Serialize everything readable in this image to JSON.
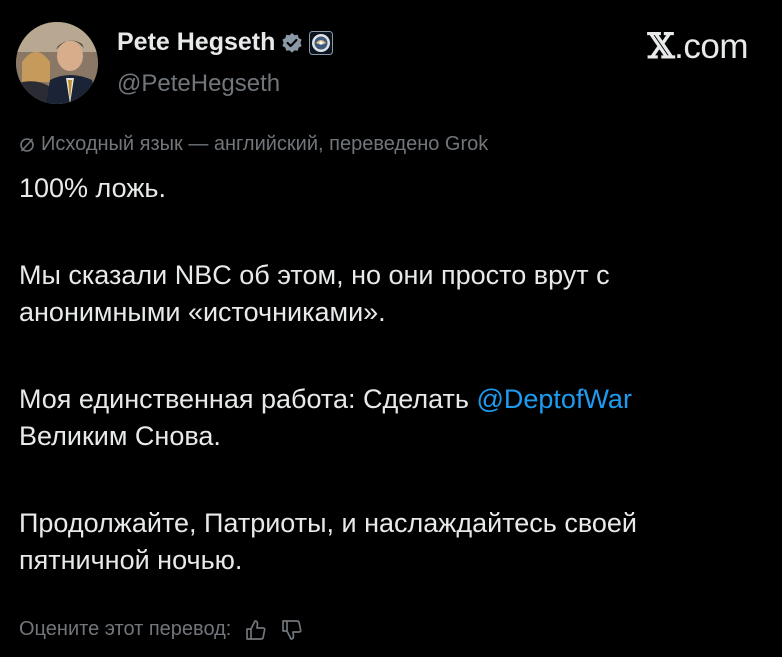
{
  "author": {
    "name": "Pete Hegseth",
    "handle": "@PeteHegseth"
  },
  "brand": {
    "x_glyph": "𝕏",
    "suffix": ".com"
  },
  "translation_note": "Исходный язык — английский, переведено Grok",
  "tweet": {
    "line1": "100% ложь.",
    "para2": "Мы сказали NBC об этом, но они просто врут с анонимными «источниками».",
    "para3_before": "Моя единственная работа: Сделать ",
    "para3_mention": "@DeptofWar",
    "para3_after": "Великим Снова.",
    "para4": "Продолжайте, Патриоты, и наслаждайтесь своей пятничной ночью."
  },
  "rating": {
    "label": "Оцените этот перевод:"
  },
  "colors": {
    "background": "#000000",
    "text": "#e7e9ea",
    "secondary": "#71767b",
    "accent": "#1d9bf0"
  },
  "icons": [
    "verified-badge-icon",
    "affiliate-seal-icon",
    "grok-icon",
    "thumbs-up-icon",
    "thumbs-down-icon"
  ]
}
